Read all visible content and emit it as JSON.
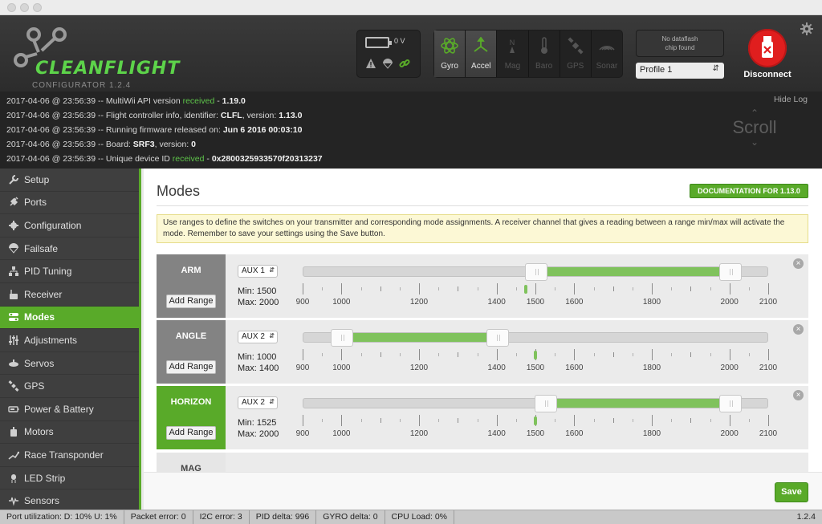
{
  "app": {
    "logo_text": "CLEANFLIGHT",
    "subtitle": "CONFIGURATOR  1.2.4"
  },
  "header": {
    "battery_voltage": "0 V",
    "sensors": [
      {
        "label": "Gyro",
        "icon": "gyro-icon",
        "active": true
      },
      {
        "label": "Accel",
        "icon": "accel-icon",
        "active": true
      },
      {
        "label": "Mag",
        "icon": "mag-icon",
        "active": false
      },
      {
        "label": "Baro",
        "icon": "baro-icon",
        "active": false
      },
      {
        "label": "GPS",
        "icon": "gps-icon",
        "active": false
      },
      {
        "label": "Sonar",
        "icon": "sonar-icon",
        "active": false
      }
    ],
    "dataflash_line1": "No dataflash",
    "dataflash_line2": "chip found",
    "profile": "Profile 1",
    "connect_label": "Disconnect",
    "accent_color": "#59aa29",
    "disconnect_color": "#e01e1e"
  },
  "log": {
    "hide_label": "Hide Log",
    "scroll_label": "Scroll",
    "lines": [
      {
        "pre": "2017-04-06 @ 23:56:39 -- MultiWii API version ",
        "ok": "received",
        "mid": " - ",
        "bold": "1.19.0",
        "post": ""
      },
      {
        "pre": "2017-04-06 @ 23:56:39 -- Flight controller info, identifier: ",
        "ok": "",
        "mid": "",
        "bold": "CLFL",
        "post": ", version: ",
        "bold2": "1.13.0"
      },
      {
        "pre": "2017-04-06 @ 23:56:39 -- Running firmware released on: ",
        "ok": "",
        "mid": "",
        "bold": "Jun 6 2016 00:03:10",
        "post": ""
      },
      {
        "pre": "2017-04-06 @ 23:56:39 -- Board: ",
        "ok": "",
        "mid": "",
        "bold": "SRF3",
        "post": ", version: ",
        "bold2": "0"
      },
      {
        "pre": "2017-04-06 @ 23:56:39 -- Unique device ID ",
        "ok": "received",
        "mid": " - ",
        "bold": "0x2800325933570f20313237",
        "post": ""
      }
    ]
  },
  "sidebar": {
    "items": [
      {
        "label": "Setup",
        "icon": "wrench-icon",
        "active": false
      },
      {
        "label": "Ports",
        "icon": "plug-icon",
        "active": false
      },
      {
        "label": "Configuration",
        "icon": "gear-icon",
        "active": false
      },
      {
        "label": "Failsafe",
        "icon": "parachute-icon",
        "active": false
      },
      {
        "label": "PID Tuning",
        "icon": "pid-icon",
        "active": false
      },
      {
        "label": "Receiver",
        "icon": "receiver-icon",
        "active": false
      },
      {
        "label": "Modes",
        "icon": "toggle-icon",
        "active": true
      },
      {
        "label": "Adjustments",
        "icon": "sliders-icon",
        "active": false
      },
      {
        "label": "Servos",
        "icon": "servo-icon",
        "active": false
      },
      {
        "label": "GPS",
        "icon": "satellite-icon",
        "active": false
      },
      {
        "label": "Power & Battery",
        "icon": "battery-icon",
        "active": false
      },
      {
        "label": "Motors",
        "icon": "motor-icon",
        "active": false
      },
      {
        "label": "Race Transponder",
        "icon": "transponder-icon",
        "active": false
      },
      {
        "label": "LED Strip",
        "icon": "led-icon",
        "active": false
      },
      {
        "label": "Sensors",
        "icon": "sensor-wave-icon",
        "active": false
      }
    ]
  },
  "main": {
    "title": "Modes",
    "doc_button": "DOCUMENTATION FOR 1.13.0",
    "note": "Use ranges to define the switches on your transmitter and corresponding mode assignments. A receiver channel that gives a reading between a range min/max will activate the mode. Remember to save your settings using the Save button.",
    "add_range_label": "Add Range",
    "save_label": "Save",
    "scale_min": 900,
    "scale_max": 2100,
    "tick_labels": [
      "900",
      "1000",
      "1200",
      "1400",
      "1500",
      "1600",
      "1800",
      "2000",
      "2100"
    ],
    "minor_ticks": [
      1100,
      1300,
      1700,
      1900
    ],
    "modes": [
      {
        "name": "ARM",
        "active": false,
        "channel": "AUX 1",
        "min": 1500,
        "max": 2000,
        "min_text": "Min: 1500",
        "max_text": "Max: 2000",
        "marker": 1475
      },
      {
        "name": "ANGLE",
        "active": false,
        "channel": "AUX 2",
        "min": 1000,
        "max": 1400,
        "min_text": "Min: 1000",
        "max_text": "Max: 1400",
        "marker": 1500
      },
      {
        "name": "HORIZON",
        "active": true,
        "channel": "AUX 2",
        "min": 1525,
        "max": 2000,
        "min_text": "Min: 1525",
        "max_text": "Max: 2000",
        "marker": 1500
      }
    ],
    "partial_mode": "MAG"
  },
  "status": {
    "port": "Port utilization: D: 10% U: 1%",
    "packet": "Packet error: 0",
    "i2c": "I2C error: 3",
    "pid": "PID delta: 996",
    "gyro": "GYRO delta: 0",
    "cpu": "CPU Load: 0%",
    "version": "1.2.4"
  }
}
